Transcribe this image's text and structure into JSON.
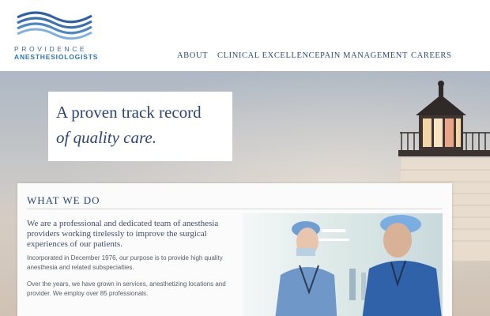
{
  "brand": {
    "name_line1": "PROVIDENCE",
    "name_line2": "ANESTHESIOLOGISTS",
    "logo_icon": "waves-logo-icon",
    "colors": {
      "primary": "#2b4576",
      "accent": "#2a74c0"
    }
  },
  "nav": {
    "items": [
      {
        "label": "ABOUT"
      },
      {
        "label": "CLINICAL EXCELLENCE"
      },
      {
        "label": "PAIN MANAGEMENT"
      },
      {
        "label": "CAREERS"
      }
    ]
  },
  "hero": {
    "tagline_line1": "A proven track record",
    "tagline_line2": "of quality care."
  },
  "about": {
    "title": "WHAT WE DO",
    "lead": "We are a professional and dedicated team of anesthesia providers working tirelessly to improve the surgical experiences of our patients.",
    "paragraph1": "Incorporated in December 1976, our purpose is to provide high quality anesthesia and related subspecialties.",
    "paragraph2": "Over the years, we have grown in services, anesthetizing locations and provider. We employ over 85 professionals."
  }
}
